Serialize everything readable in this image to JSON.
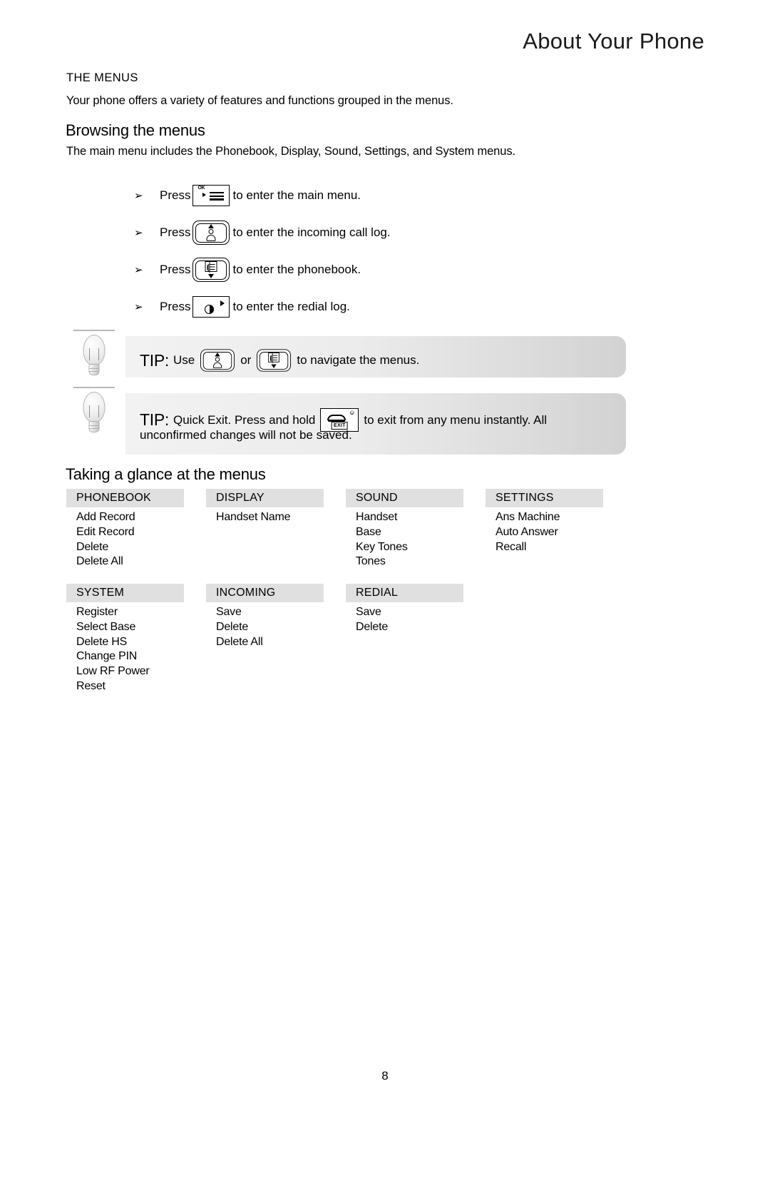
{
  "header": {
    "title": "About Your Phone"
  },
  "sections": {
    "menus_label": "THE MENUS",
    "intro": "Your phone offers a variety of features and functions grouped in the menus.",
    "browsing_heading": "Browsing the menus",
    "browsing_intro": "The main menu includes the Phonebook, Display, Sound, Settings, and System menus.",
    "glance_heading": "Taking a glance at the menus"
  },
  "bullets": [
    {
      "marker": "➢",
      "pre": "Press",
      "icon": "menu-ok-key-icon",
      "post": "to enter the main menu."
    },
    {
      "marker": "➢",
      "pre": "Press",
      "icon": "up-call-log-key-icon",
      "post": "to enter the incoming call log."
    },
    {
      "marker": "➢",
      "pre": "Press",
      "icon": "down-phonebook-key-icon",
      "post": "to enter the phonebook."
    },
    {
      "marker": "➢",
      "pre": "Press",
      "icon": "redial-key-icon",
      "post": "to enter the redial log."
    }
  ],
  "tips": [
    {
      "label": "TIP:",
      "text_before": "Use",
      "icon_1": "up-call-log-key-icon",
      "conjunction": "or",
      "icon_2": "down-phonebook-key-icon",
      "text_after": "to navigate the menus."
    },
    {
      "label": "TIP:",
      "text_before": "Quick Exit. Press and hold",
      "icon_1": "exit-end-call-key-icon",
      "text_after": "to exit from any menu instantly. All",
      "line2": "unconfirmed changes will not be saved."
    }
  ],
  "menu_tables": {
    "row1": [
      {
        "title": "PHONEBOOK",
        "items": [
          "Add Record",
          "Edit Record",
          "Delete",
          "Delete All"
        ]
      },
      {
        "title": "DISPLAY",
        "items": [
          "Handset Name"
        ]
      },
      {
        "title": "SOUND",
        "items": [
          "Handset",
          "Base",
          "Key Tones",
          "Tones"
        ]
      },
      {
        "title": "SETTINGS",
        "items": [
          "Ans Machine",
          "Auto Answer",
          "Recall"
        ]
      }
    ],
    "row2": [
      {
        "title": "SYSTEM",
        "items": [
          "Register",
          "Select Base",
          "Delete HS",
          "Change PIN",
          "Low RF Power",
          "Reset"
        ]
      },
      {
        "title": "INCOMING",
        "items": [
          "Save",
          "Delete",
          "Delete All"
        ]
      },
      {
        "title": "REDIAL",
        "items": [
          "Save",
          "Delete"
        ]
      }
    ]
  },
  "footer": {
    "page_number": "8"
  },
  "colors": {
    "header_bg": "#e0e0e0",
    "tip_bg_light": "#f2f2f2",
    "tip_bg_dark": "#d2d2d2",
    "text": "#000000"
  }
}
